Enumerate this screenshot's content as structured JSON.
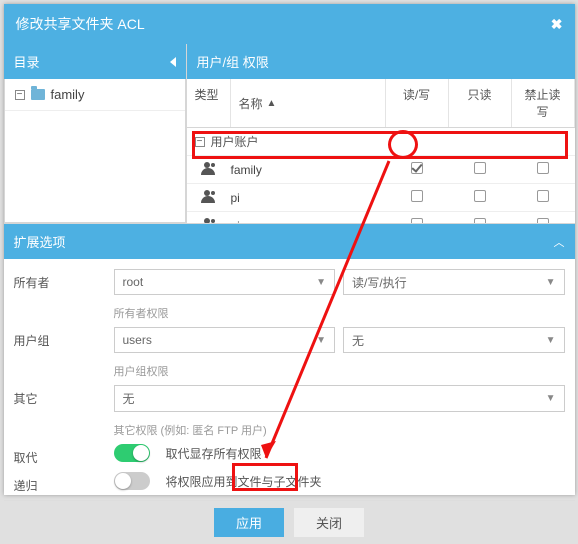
{
  "dialog": {
    "title": "修改共享文件夹 ACL"
  },
  "left": {
    "header": "目录",
    "tree_item": "family"
  },
  "right": {
    "header": "用户/组 权限",
    "cols": {
      "type": "类型",
      "name": "名称",
      "rw": "读/写",
      "ro": "只读",
      "deny": "禁止读写"
    },
    "group_label": "用户账户",
    "rows": [
      {
        "name": "family",
        "rw": true,
        "ro": false,
        "deny": false
      },
      {
        "name": "pi",
        "rw": false,
        "ro": false,
        "deny": false
      },
      {
        "name": "pi",
        "rw": false,
        "ro": false,
        "deny": false
      }
    ]
  },
  "ext": {
    "header": "扩展选项",
    "owner_label": "所有者",
    "owner_value": "root",
    "owner_hint": "所有者权限",
    "owner_perm": "读/写/执行",
    "group_label": "用户组",
    "group_value": "users",
    "group_hint": "用户组权限",
    "group_perm": "无",
    "other_label": "其它",
    "other_value": "无",
    "other_hint": "其它权限 (例如: 匿名 FTP 用户)",
    "replace_label": "取代",
    "replace_toggle_on": true,
    "replace_text": "取代显存所有权限",
    "recursive_label": "递归",
    "recursive_toggle_on": false,
    "recursive_text": "将权限应用到文件与子文件夹"
  },
  "footer": {
    "apply": "应用",
    "close": "关闭"
  }
}
